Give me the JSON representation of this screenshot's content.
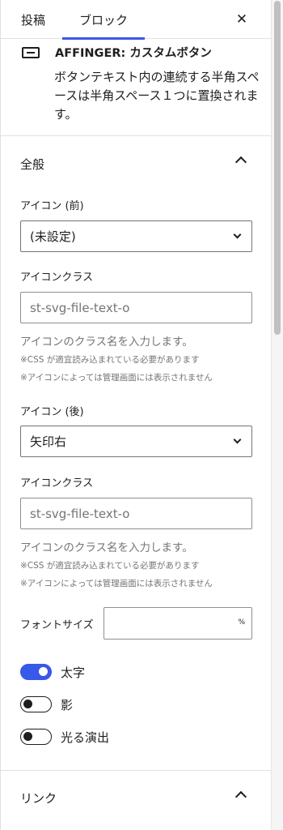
{
  "tabs": {
    "post": "投稿",
    "block": "ブロック"
  },
  "block_card": {
    "title": "AFFINGER: カスタムボタン",
    "description": "ボタンテキスト内の連続する半角スペースは半角スペース１つに置換されます。"
  },
  "general": {
    "title": "全般",
    "icon_before_label": "アイコン (前)",
    "icon_before_value": "(未設定)",
    "icon_class_label_1": "アイコンクラス",
    "icon_class_placeholder_1": "st-svg-file-text-o",
    "help_1": "アイコンのクラス名を入力します。",
    "note_css_1": "※CSS が適宜読み込まれている必要があります",
    "note_icon_1": "※アイコンによっては管理画面には表示されません",
    "icon_after_label": "アイコン (後)",
    "icon_after_value": "矢印右",
    "icon_class_label_2": "アイコンクラス",
    "icon_class_placeholder_2": "st-svg-file-text-o",
    "help_2": "アイコンのクラス名を入力します。",
    "note_css_2": "※CSS が適宜読み込まれている必要があります",
    "note_icon_2": "※アイコンによっては管理画面には表示されません",
    "font_size_label": "フォントサイズ",
    "font_size_unit": "%",
    "font_size_value": "",
    "toggles": [
      {
        "label": "太字",
        "on": true
      },
      {
        "label": "影",
        "on": false
      },
      {
        "label": "光る演出",
        "on": false
      }
    ]
  },
  "link": {
    "title": "リンク"
  },
  "colors": {
    "accent": "#3858e9",
    "border": "#e0e0e0",
    "muted": "#757575"
  }
}
